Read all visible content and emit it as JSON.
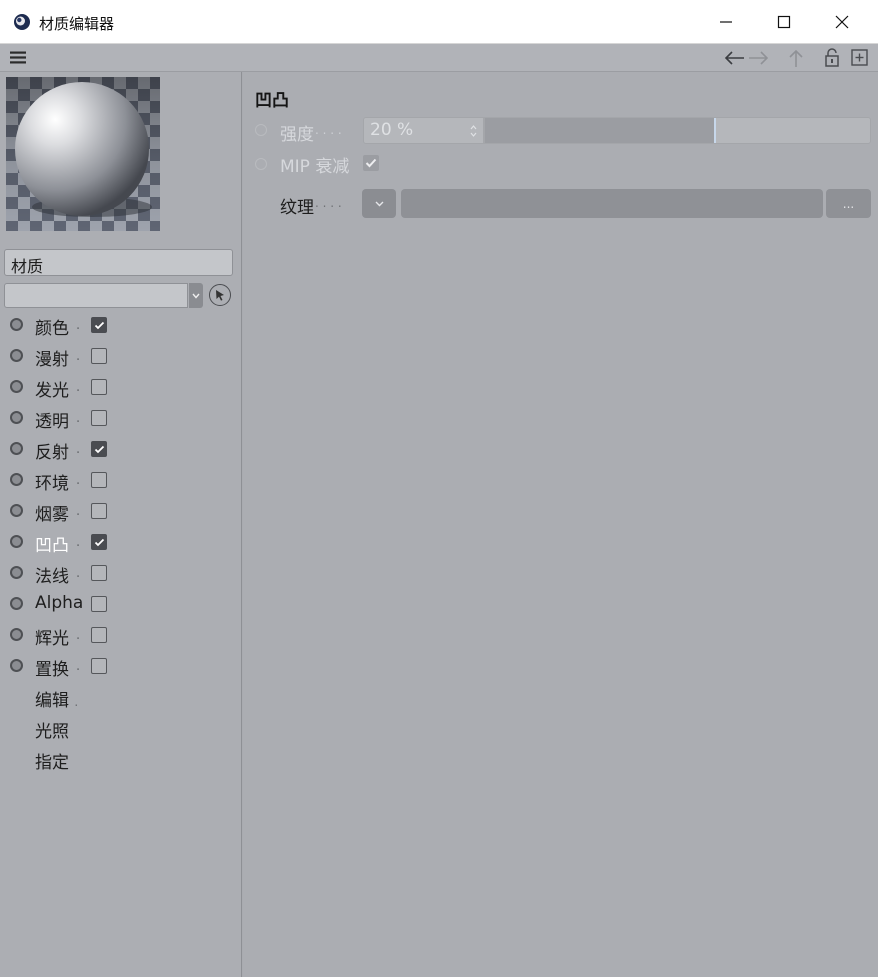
{
  "window": {
    "title": "材质编辑器"
  },
  "material": {
    "name": "材质"
  },
  "channels": [
    {
      "label": "颜色",
      "checked": true,
      "active": false
    },
    {
      "label": "漫射",
      "checked": false,
      "active": false
    },
    {
      "label": "发光",
      "checked": false,
      "active": false
    },
    {
      "label": "透明",
      "checked": false,
      "active": false
    },
    {
      "label": "反射",
      "checked": true,
      "active": false
    },
    {
      "label": "环境",
      "checked": false,
      "active": false
    },
    {
      "label": "烟雾",
      "checked": false,
      "active": false
    },
    {
      "label": "凹凸",
      "checked": true,
      "active": true
    },
    {
      "label": "法线",
      "checked": false,
      "active": false
    },
    {
      "label": "Alpha",
      "checked": false,
      "active": false
    },
    {
      "label": "辉光",
      "checked": false,
      "active": false
    },
    {
      "label": "置换",
      "checked": false,
      "active": false
    }
  ],
  "extra_items": [
    "编辑",
    "光照",
    "指定"
  ],
  "bump": {
    "title": "凹凸",
    "strength_label": "强度",
    "strength_value": "20 %",
    "strength_fraction": 0.6,
    "mip_label": "MIP 衰减",
    "mip_checked": true,
    "texture_label": "纹理",
    "browse_label": "..."
  },
  "label_dots": ". . . .",
  "icons": {
    "menu": "hamburger-icon",
    "back": "arrow-left-icon",
    "forward": "arrow-right-icon",
    "up": "arrow-up-icon",
    "lock": "lock-icon",
    "new_panel": "new-window-icon"
  },
  "colors": {
    "active_label": "#ffffff",
    "slider_fill": "#9b9da2"
  }
}
